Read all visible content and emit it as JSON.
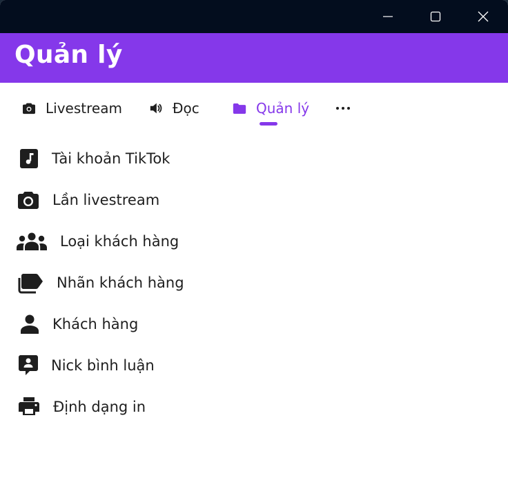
{
  "window": {
    "controls": {
      "minimize": "minimize-icon",
      "maximize": "maximize-icon",
      "close": "close-icon"
    }
  },
  "header": {
    "title": "Quản lý",
    "color": "#8538ea"
  },
  "tabs": [
    {
      "label": "Livestream",
      "icon": "camera-icon",
      "active": false
    },
    {
      "label": "Đọc",
      "icon": "speaker-icon",
      "active": false
    },
    {
      "label": "Quản lý",
      "icon": "folder-icon",
      "active": true
    }
  ],
  "more_icon": "more-horizontal-icon",
  "menu": {
    "items": [
      {
        "label": "Tài khoản TikTok",
        "icon": "music-note-icon"
      },
      {
        "label": "Lần livestream",
        "icon": "camera-icon"
      },
      {
        "label": "Loại khách hàng",
        "icon": "people-group-icon"
      },
      {
        "label": "Nhãn khách hàng",
        "icon": "labels-icon"
      },
      {
        "label": "Khách hàng",
        "icon": "person-icon"
      },
      {
        "label": "Nick bình luận",
        "icon": "comment-user-icon"
      },
      {
        "label": "Định dạng in",
        "icon": "printer-icon"
      }
    ]
  }
}
